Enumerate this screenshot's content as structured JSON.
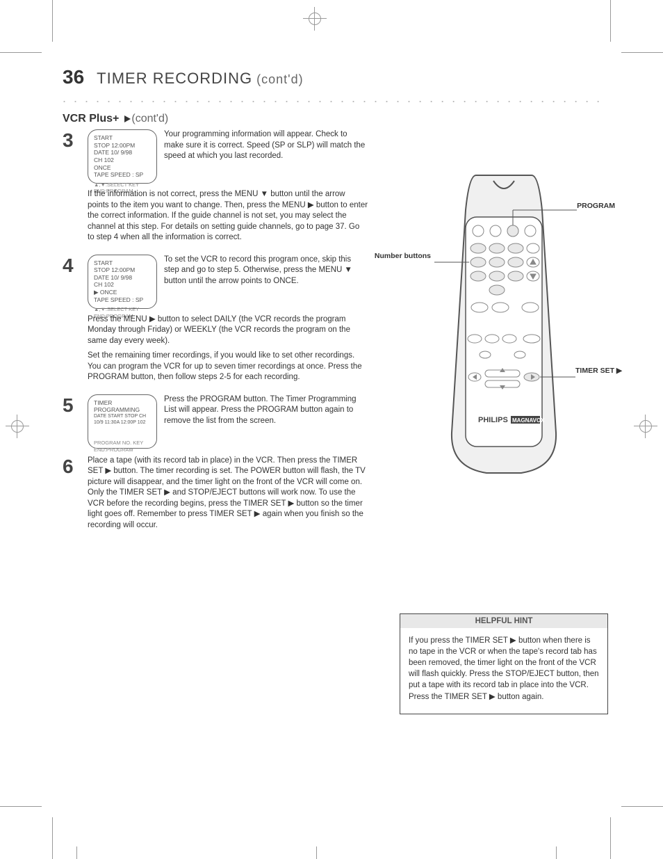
{
  "page_number": "36",
  "header_title": "TIMER RECORDING",
  "header_subtitle": "(cont'd)",
  "section1_title": "VCR Plus+",
  "section1_title_suffix": " (cont'd)",
  "steps": [
    {
      "num": "3",
      "screen": {
        "line1": "START",
        "line2": "STOP   12:00PM",
        "line3": "DATE   10/ 9/98",
        "line4": "CH     102",
        "line5": "ONCE",
        "line6": "TAPE SPEED : SP",
        "hint": "▲,▼:SELECT KEY     END:PROGRAM"
      },
      "paragraphs": [
        "Your programming information will appear. Check to make sure it is correct. Speed (SP or SLP) will match the speed at which you last recorded.",
        "If the information is not correct, press the MENU ▼ button until the arrow points to the item you want to change. Then, press the MENU ▶ button to enter the correct information. If the guide channel is not set, you may select the channel at this step. For details on setting guide channels, go to page 37. Go to step 4 when all the information is correct."
      ]
    },
    {
      "num": "4",
      "screen": {
        "line1": "START",
        "line2": "STOP   12:00PM",
        "line3": "DATE   10/ 9/98",
        "line4": "CH     102",
        "line5": "▶ ONCE",
        "line6": "TAPE SPEED : SP",
        "hint": "▲,▼:SELECT KEY     END:PROGRAM"
      },
      "paragraphs": [
        "To set the VCR to record this program once, skip this step and go to step 5. Otherwise, press the MENU ▼ button until the arrow points to ONCE.",
        "Press the MENU ▶ button to select DAILY (the VCR records the program Monday through Friday) or WEEKLY (the VCR records the program on the same day every week).",
        "Set the remaining timer recordings, if you would like to set other recordings. You can program the VCR for up to seven timer recordings at once. Press the PROGRAM button, then follow steps 2-5 for each recording."
      ]
    },
    {
      "num": "5",
      "screen": {
        "line1": "TIMER PROGRAMMING",
        "line2": "DATE START STOP CH",
        "line3": "10/9 11:30A 12:00P 102",
        "hint": "PROGRAM NO. KEY    END:PROGRAM"
      },
      "paragraphs": [
        "Press the PROGRAM button. The Timer Programming List will appear. Press the PROGRAM button again to remove the list from the screen."
      ]
    },
    {
      "num": "6",
      "paragraphs": [
        "Place a tape (with its record tab in place) in the VCR. Then press the TIMER SET ▶ button. The timer recording is set. The POWER button will flash, the TV picture will disappear, and the timer light on the front of the VCR will come on. Only the TIMER SET ▶ and STOP/EJECT buttons will work now. To use the VCR before the recording begins, press the TIMER SET ▶ button so the timer light goes off. Remember to press TIMER SET ▶ again when you finish so the recording will occur."
      ]
    }
  ],
  "callouts": {
    "program": "PROGRAM",
    "numbers": "Number buttons",
    "timer": "TIMER SET ▶"
  },
  "remote_brand1": "PHILIPS",
  "remote_brand2": "MAGNAVOX",
  "helpful_hint": {
    "title": "HELPFUL HINT",
    "body": "If you press the TIMER SET ▶ button when there is no tape in the VCR or when the tape's record tab has been removed, the timer light on the front of the VCR will flash quickly. Press the STOP/EJECT button, then put a tape with its record tab in place into the VCR. Press the TIMER SET ▶ button again."
  }
}
